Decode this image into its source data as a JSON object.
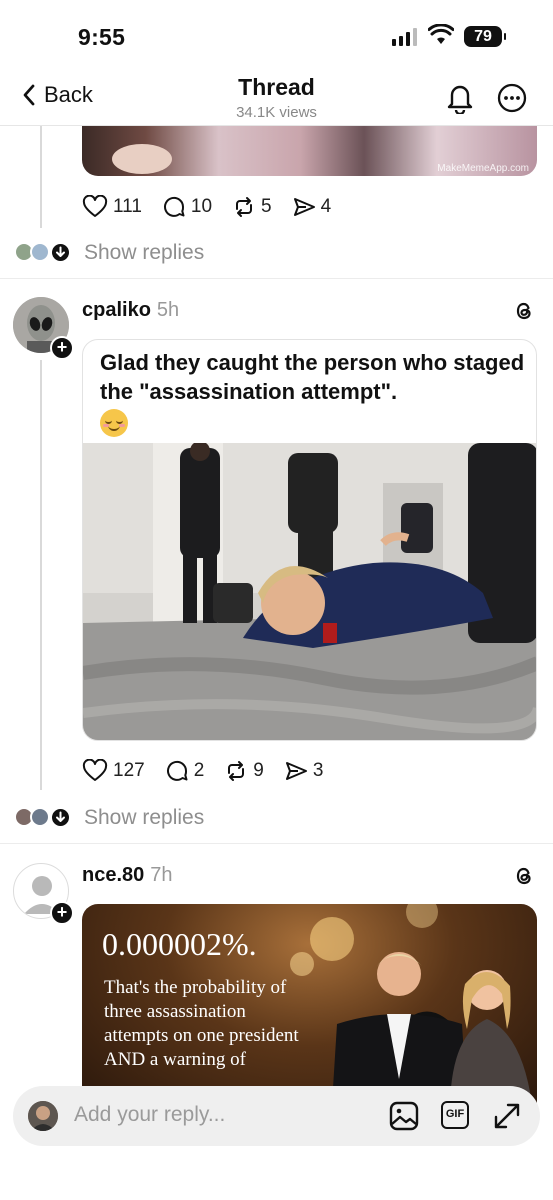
{
  "status_bar": {
    "time": "9:55",
    "battery": "79"
  },
  "header": {
    "back_label": "Back",
    "title": "Thread",
    "views": "34.1K views"
  },
  "top_post": {
    "media_watermark": "MakeMemeApp.com",
    "likes": "111",
    "comments": "10",
    "reposts": "5",
    "shares": "4",
    "show_replies": "Show replies"
  },
  "post1": {
    "username": "cpaliko",
    "time": "5h",
    "quote_text": "Glad they caught the person who staged the \"assassination attempt\".",
    "likes": "127",
    "comments": "2",
    "reposts": "9",
    "shares": "3",
    "show_replies": "Show replies"
  },
  "post2": {
    "username": "nce.80",
    "time": "7h",
    "meme_headline": "0.000002%.",
    "meme_caption": "That's the probability of three assassination attempts on one president AND a warning of"
  },
  "reply_bar": {
    "placeholder": "Add your reply...",
    "gif_label": "GIF"
  },
  "colors": {
    "text": "#111111",
    "muted": "#8e8e8e",
    "divider": "#ececec",
    "reply_bg": "#efefef"
  }
}
